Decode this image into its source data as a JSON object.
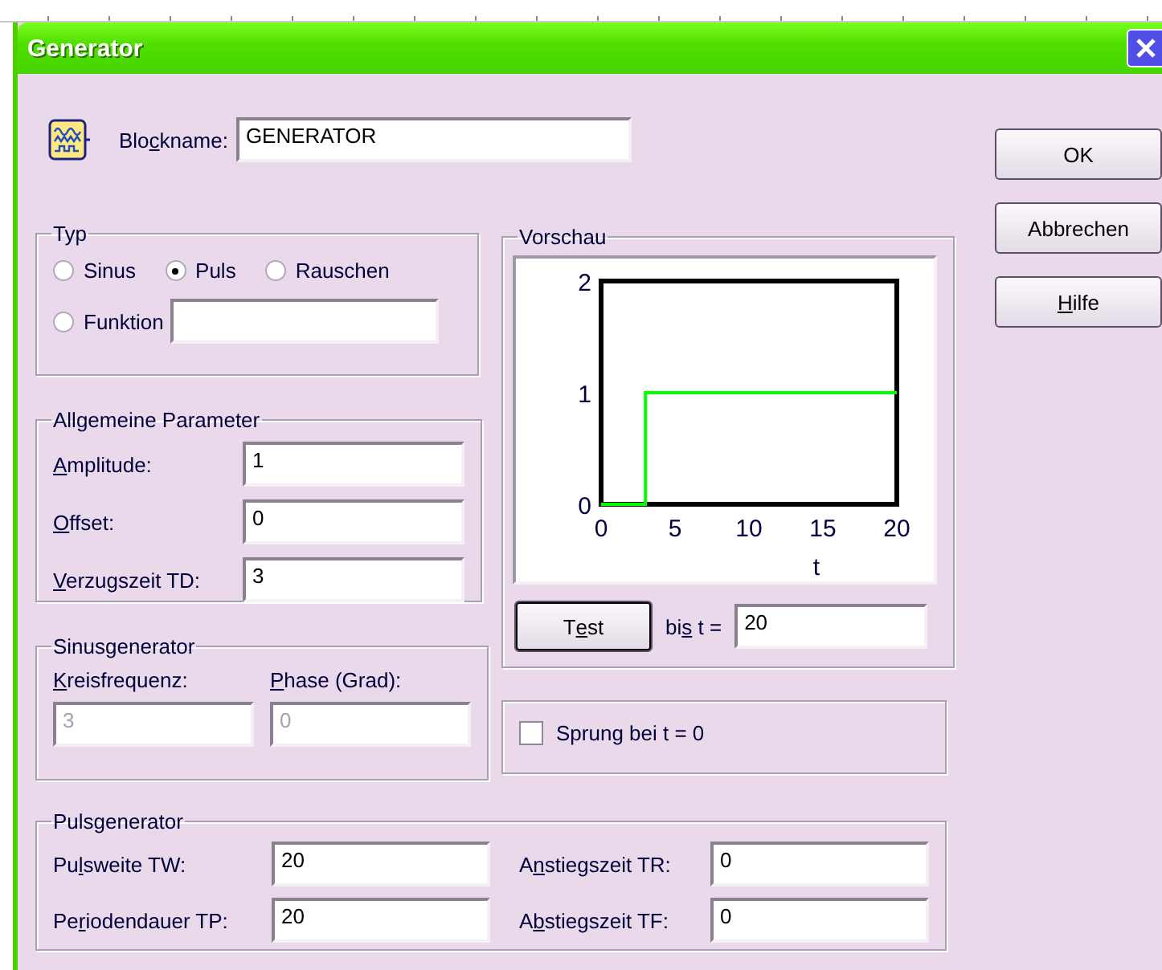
{
  "window": {
    "title": "Generator"
  },
  "block_name": {
    "label": {
      "before": "Blo",
      "key": "c",
      "after": "kname:"
    },
    "value": "GENERATOR"
  },
  "buttons": [
    {
      "label": {
        "before": "OK"
      }
    },
    {
      "label": {
        "before": "Abbrechen"
      }
    },
    {
      "label": {
        "key": "H",
        "after": "ilfe"
      }
    }
  ],
  "type_group": {
    "title": "Typ",
    "options": [
      {
        "kind": "plain",
        "label": {
          "before": "Sinus"
        },
        "selected": false
      },
      {
        "kind": "plain",
        "label": {
          "before": "Puls"
        },
        "selected": true
      },
      {
        "kind": "plain",
        "label": {
          "before": "Rauschen"
        },
        "selected": false
      },
      {
        "kind": "with-field",
        "label": {
          "before": "Funktion"
        },
        "selected": false
      }
    ]
  },
  "general_group": {
    "title": "Allgemeine Parameter",
    "fields": [
      {
        "label": {
          "key": "A",
          "after": "mplitude:"
        },
        "value": "1"
      },
      {
        "label": {
          "key": "O",
          "after": "ffset:"
        },
        "value": "0"
      },
      {
        "label": {
          "key": "V",
          "after": "erzugszeit TD:"
        },
        "value": "3"
      }
    ]
  },
  "sine_group": {
    "title": "Sinusgenerator",
    "fields": [
      {
        "label": {
          "key": "K",
          "after": "reisfrequenz:"
        },
        "value": "3",
        "disabled": true
      },
      {
        "label": {
          "key": "P",
          "after": "hase (Grad):"
        },
        "value": "0",
        "disabled": true
      }
    ]
  },
  "preview_group": {
    "title": "Vorschau",
    "chart_data": {
      "type": "line",
      "xlabel": "t",
      "x": [
        0,
        3,
        3,
        20
      ],
      "series": [
        {
          "color": "#00ff00",
          "values": [
            0,
            0,
            1,
            1
          ]
        }
      ],
      "xlim": [
        0,
        20
      ],
      "ylim": [
        0,
        2
      ],
      "xticks": [
        0,
        5,
        10,
        15,
        20
      ],
      "yticks": [
        0,
        1,
        2
      ]
    },
    "test_button": {
      "label": {
        "before": "T",
        "key": "e",
        "after": "st"
      }
    },
    "until": {
      "label": {
        "before": "bi",
        "key": "s",
        "after": " t ="
      },
      "value": "20"
    }
  },
  "step_group": {
    "checkbox": {
      "label": {
        "before": "Sprung bei t = 0"
      },
      "checked": false
    }
  },
  "pulse_group": {
    "title": "Pulsgenerator",
    "fields": [
      {
        "label": {
          "before": "Pu",
          "key": "l",
          "after": "sweite TW:"
        },
        "value": "20"
      },
      {
        "label": {
          "before": "A",
          "key": "n",
          "after": "stiegszeit TR:"
        },
        "value": "0"
      },
      {
        "label": {
          "before": "Pe",
          "key": "r",
          "after": "iodendauer TP:"
        },
        "value": "20"
      },
      {
        "label": {
          "before": "A",
          "key": "b",
          "after": "stiegszeit TF:"
        },
        "value": "0"
      }
    ]
  }
}
